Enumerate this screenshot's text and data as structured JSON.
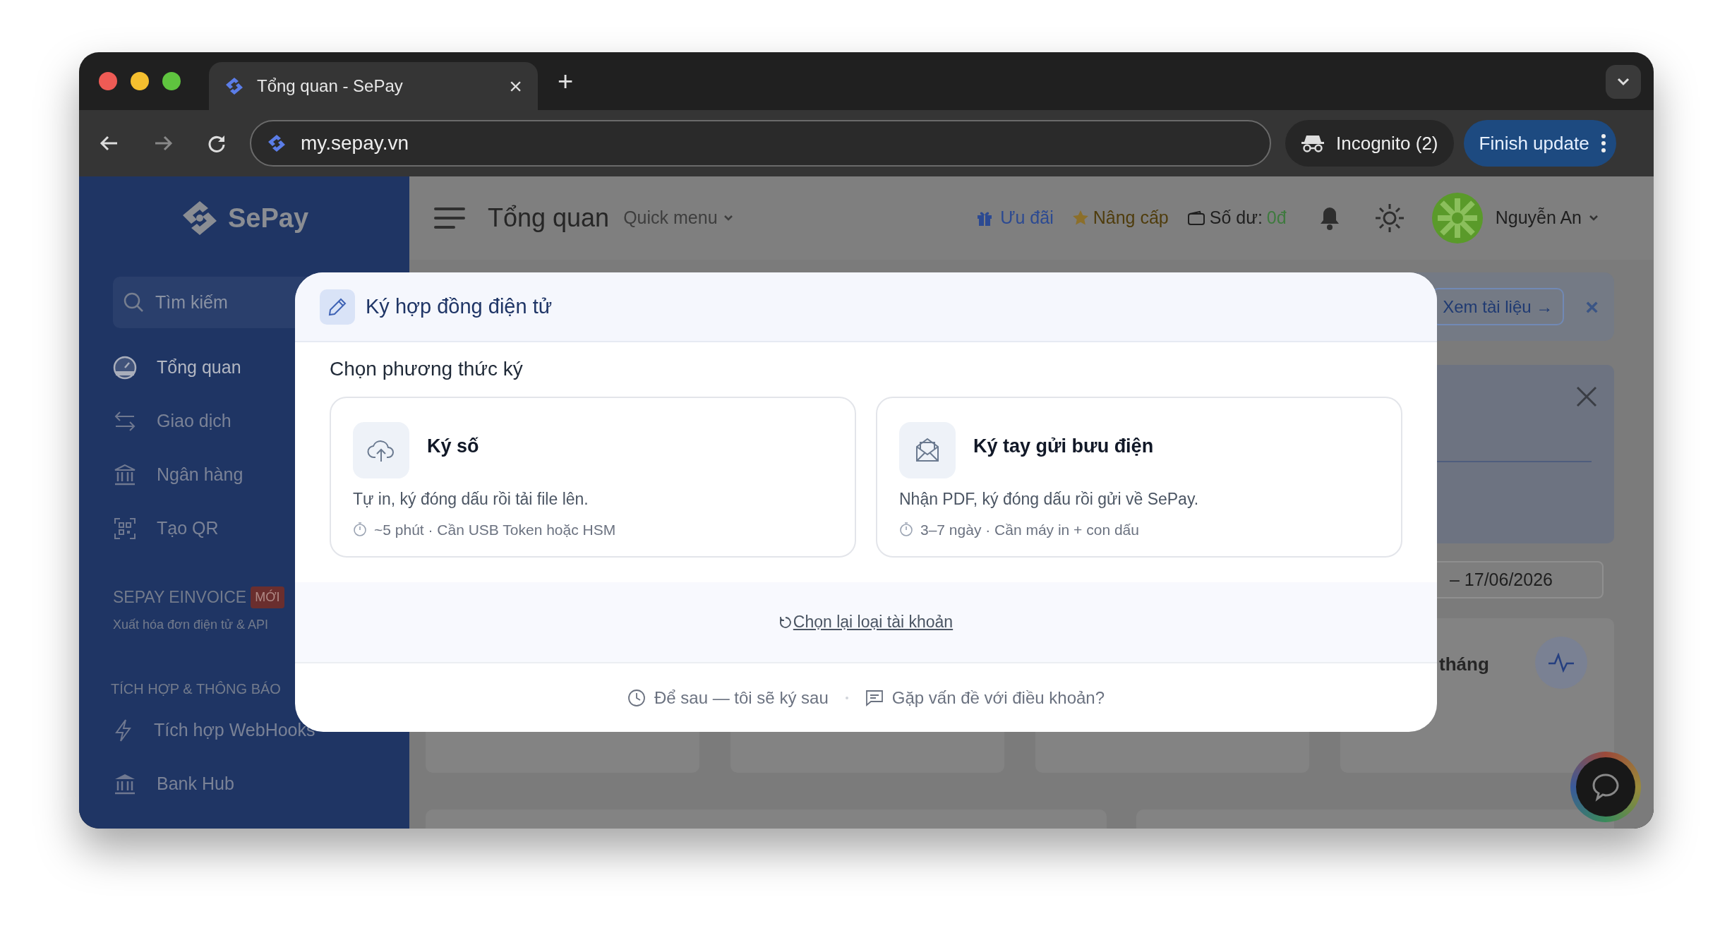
{
  "browser": {
    "tab_title": "Tổng quan - SePay",
    "close": "×",
    "new_tab": "+",
    "url": "my.sepay.vn",
    "incognito": "Incognito (2)",
    "update": "Finish update"
  },
  "sidebar": {
    "logo": "SePay",
    "search": {
      "placeholder": "Tìm kiếm"
    },
    "items": [
      {
        "label": "Tổng quan",
        "selected": true
      },
      {
        "label": "Giao dịch",
        "selected": false
      },
      {
        "label": "Ngân hàng",
        "selected": false
      },
      {
        "label": "Tạo QR",
        "selected": false
      }
    ],
    "einvoice": {
      "title": "SEPAY EINVOICE",
      "badge": "MỚI",
      "subtitle": "Xuất hóa đơn điện tử & API"
    },
    "section": {
      "title": "TÍCH HỢP & THÔNG BÁO",
      "items": [
        {
          "label": "Tích hợp WebHooks"
        },
        {
          "label": "Bank Hub"
        }
      ]
    }
  },
  "header": {
    "title": "Tổng quan",
    "quick_menu": "Quick menu",
    "promo": "Ưu đãi",
    "upgrade": "Nâng cấp",
    "balance_label": "Số dư:",
    "balance": "0đ",
    "user": "Nguyễn An"
  },
  "notice": {
    "docs_button": "Xem tài liệu →",
    "close": "×"
  },
  "date_range": {
    "value": "– 17/06/2026"
  },
  "stats_card": {
    "title": "tháng"
  },
  "modal": {
    "title": "Ký hợp đồng điện tử",
    "heading": "Chọn phương thức ký",
    "options": [
      {
        "title": "Ký số",
        "description": "Tự in, ký đóng dấu rồi tải file lên.",
        "meta": "~5 phút · Cần USB Token hoặc HSM"
      },
      {
        "title": "Ký tay gửi bưu điện",
        "description": "Nhận PDF, ký đóng dấu rồi gửi về SePay.",
        "meta": "3–7 ngày · Cần máy in + con dấu"
      }
    ],
    "reset_link": "Chọn lại loại tài khoản",
    "later": "Để sau — tôi sẽ ký sau",
    "issue": "Gặp vấn đề với điều khoản?"
  }
}
